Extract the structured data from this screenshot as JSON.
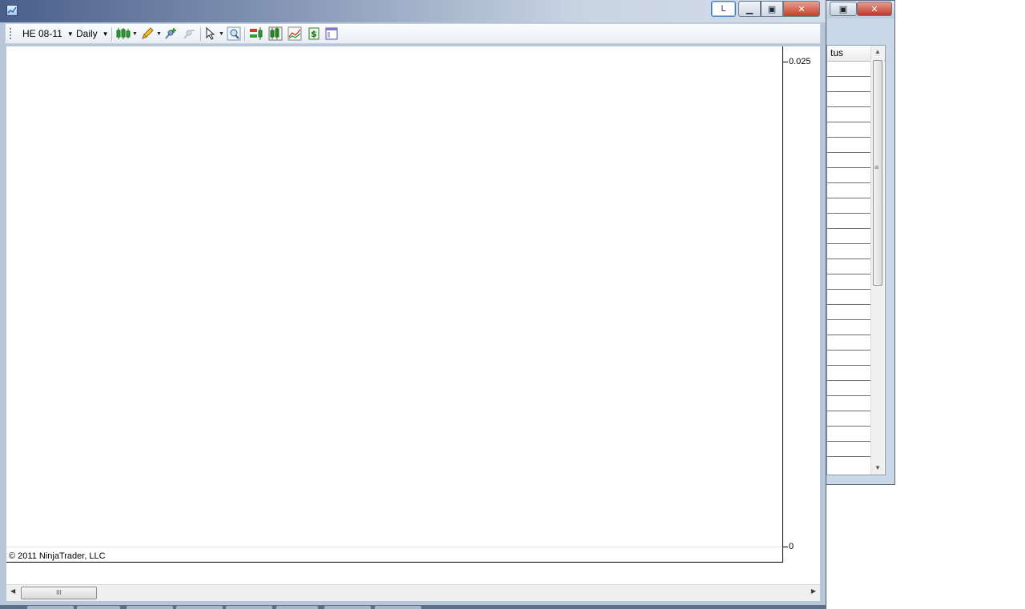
{
  "window": {
    "lock_label": "L",
    "minimize_glyph": "▁",
    "maximize_glyph": "▣",
    "close_glyph": "✕"
  },
  "toolbar": {
    "instrument": "HE 08-11",
    "interval": "Daily",
    "icons": [
      "candlestick-icon",
      "pencil-draw-icon",
      "add-indicator-icon",
      "remove-indicator-icon",
      "cursor-pointer-icon",
      "zoom-icon",
      "order-entry-icon",
      "chart-trader-icon",
      "strategy-chart-icon",
      "account-dollar-icon",
      "window-layout-icon"
    ]
  },
  "chart": {
    "y_ticks": [
      "0.025",
      "0"
    ],
    "copyright": "© 2011 NinjaTrader, LLC"
  },
  "chart_data": {
    "type": "line",
    "title": "",
    "xlabel": "",
    "ylabel": "",
    "ylim": [
      0,
      0.025
    ],
    "series": [],
    "grid": false
  },
  "scrollbar": {
    "left_arrow": "◀",
    "right_arrow": "▶",
    "thumb_grip": "III"
  },
  "background_window": {
    "column_header": "tus",
    "minimize_glyph": "▣",
    "close_glyph": "✕",
    "scroll_up": "▲",
    "scroll_down": "▼",
    "scroll_grip": "≡"
  },
  "colors": {
    "titlebar_dark": "#4a5f8a",
    "close_red": "#c4402c",
    "candle_green": "#2e9e2e"
  }
}
